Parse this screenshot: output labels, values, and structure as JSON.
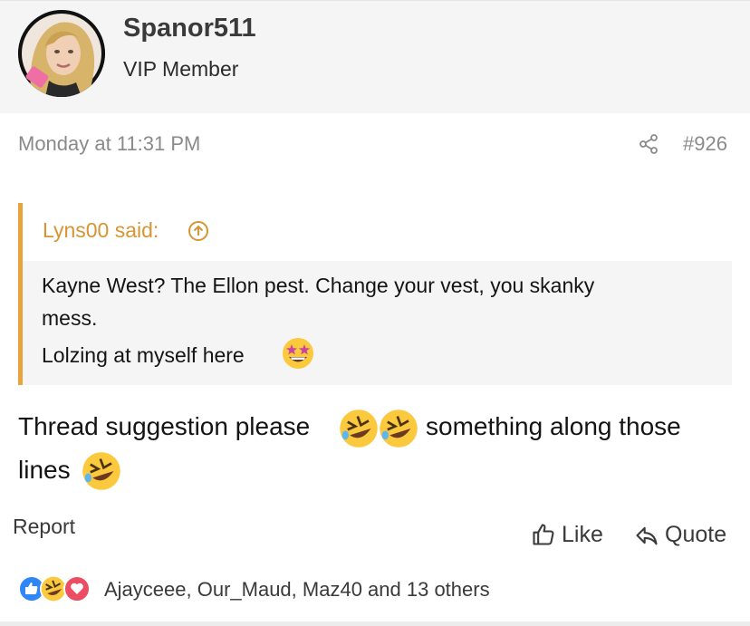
{
  "post": {
    "username": "Spanor511",
    "user_title": "VIP Member",
    "date": "Monday at 11:31 PM",
    "post_number": "#926"
  },
  "quote": {
    "header": "Lyns00 said:",
    "line1": "Kayne West? The Ellon pest. Change your vest, you skanky",
    "line2": "mess.",
    "line3": "Lolzing at myself here"
  },
  "message": {
    "line1_part1": "Thread suggestion please",
    "line1_part2": "something along those",
    "line2": "lines"
  },
  "actions": {
    "report": "Report",
    "like": "Like",
    "quote": "Quote"
  },
  "reactions": {
    "summary": "Ajayceee, Our_Maud, Maz40 and 13 others",
    "icons": [
      "like-icon",
      "laughing-emoji-icon",
      "love-icon"
    ]
  },
  "colors": {
    "quote_accent": "#e8a33d",
    "like_blue": "#2f86f6",
    "love_red": "#ec4d62"
  }
}
